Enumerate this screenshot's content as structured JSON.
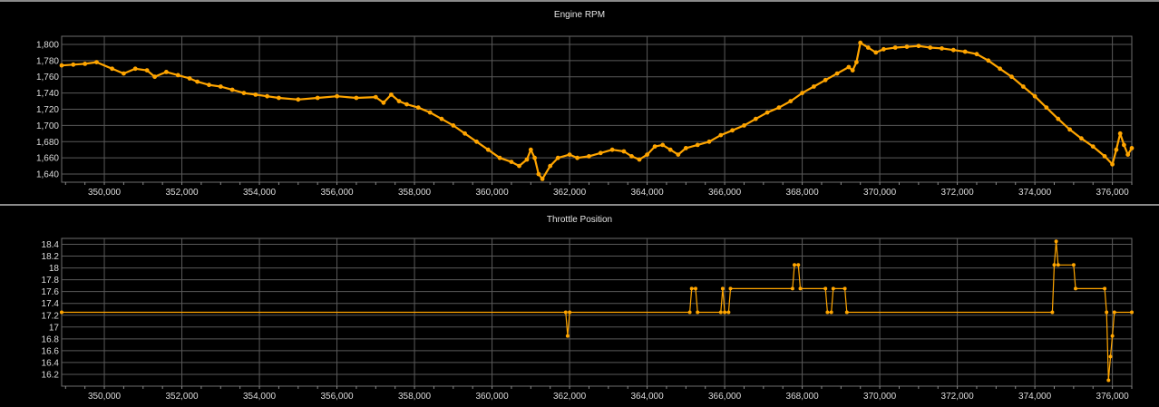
{
  "chart_data": [
    {
      "type": "line",
      "title": "Engine RPM",
      "xlabel": "",
      "ylabel": "",
      "xlim": [
        348900,
        376500
      ],
      "ylim": [
        1630,
        1810
      ],
      "x_ticks": [
        350000,
        352000,
        354000,
        356000,
        358000,
        360000,
        362000,
        364000,
        366000,
        368000,
        370000,
        372000,
        374000,
        376000
      ],
      "x_tick_labels": [
        "350,000",
        "352,000",
        "354,000",
        "356,000",
        "358,000",
        "360,000",
        "362,000",
        "364,000",
        "366,000",
        "368,000",
        "370,000",
        "372,000",
        "374,000",
        "376,000"
      ],
      "y_ticks": [
        1640,
        1660,
        1680,
        1700,
        1720,
        1740,
        1760,
        1780,
        1800
      ],
      "y_tick_labels": [
        "1,640",
        "1,660",
        "1,680",
        "1,700",
        "1,720",
        "1,740",
        "1,760",
        "1,780",
        "1,800"
      ],
      "grid": true,
      "color": "#FFA500",
      "series": [
        {
          "points": [
            [
              348900,
              1774
            ],
            [
              349200,
              1775
            ],
            [
              349500,
              1776
            ],
            [
              349800,
              1778
            ],
            [
              350200,
              1770
            ],
            [
              350500,
              1764
            ],
            [
              350800,
              1770
            ],
            [
              351100,
              1768
            ],
            [
              351300,
              1760
            ],
            [
              351600,
              1766
            ],
            [
              351900,
              1762
            ],
            [
              352200,
              1758
            ],
            [
              352400,
              1754
            ],
            [
              352700,
              1750
            ],
            [
              353000,
              1748
            ],
            [
              353300,
              1744
            ],
            [
              353600,
              1740
            ],
            [
              353900,
              1738
            ],
            [
              354200,
              1736
            ],
            [
              354500,
              1734
            ],
            [
              355000,
              1732
            ],
            [
              355500,
              1734
            ],
            [
              356000,
              1736
            ],
            [
              356500,
              1734
            ],
            [
              357000,
              1735
            ],
            [
              357200,
              1728
            ],
            [
              357400,
              1738
            ],
            [
              357600,
              1730
            ],
            [
              357800,
              1726
            ],
            [
              358100,
              1722
            ],
            [
              358400,
              1716
            ],
            [
              358700,
              1708
            ],
            [
              359000,
              1700
            ],
            [
              359300,
              1690
            ],
            [
              359600,
              1680
            ],
            [
              359900,
              1670
            ],
            [
              360200,
              1660
            ],
            [
              360500,
              1655
            ],
            [
              360700,
              1650
            ],
            [
              360900,
              1658
            ],
            [
              361000,
              1670
            ],
            [
              361100,
              1660
            ],
            [
              361200,
              1640
            ],
            [
              361300,
              1634
            ],
            [
              361500,
              1650
            ],
            [
              361700,
              1660
            ],
            [
              362000,
              1664
            ],
            [
              362200,
              1660
            ],
            [
              362500,
              1662
            ],
            [
              362800,
              1666
            ],
            [
              363100,
              1670
            ],
            [
              363400,
              1668
            ],
            [
              363600,
              1662
            ],
            [
              363800,
              1658
            ],
            [
              364000,
              1664
            ],
            [
              364200,
              1674
            ],
            [
              364400,
              1676
            ],
            [
              364600,
              1670
            ],
            [
              364800,
              1664
            ],
            [
              365000,
              1672
            ],
            [
              365300,
              1676
            ],
            [
              365600,
              1680
            ],
            [
              365900,
              1688
            ],
            [
              366200,
              1694
            ],
            [
              366500,
              1700
            ],
            [
              366800,
              1708
            ],
            [
              367100,
              1716
            ],
            [
              367400,
              1722
            ],
            [
              367700,
              1730
            ],
            [
              368000,
              1740
            ],
            [
              368300,
              1748
            ],
            [
              368600,
              1756
            ],
            [
              368900,
              1764
            ],
            [
              369200,
              1772
            ],
            [
              369300,
              1768
            ],
            [
              369400,
              1778
            ],
            [
              369500,
              1802
            ],
            [
              369700,
              1796
            ],
            [
              369900,
              1790
            ],
            [
              370100,
              1794
            ],
            [
              370400,
              1796
            ],
            [
              370700,
              1797
            ],
            [
              371000,
              1798
            ],
            [
              371300,
              1796
            ],
            [
              371600,
              1795
            ],
            [
              371900,
              1793
            ],
            [
              372200,
              1791
            ],
            [
              372500,
              1788
            ],
            [
              372800,
              1780
            ],
            [
              373100,
              1770
            ],
            [
              373400,
              1760
            ],
            [
              373700,
              1748
            ],
            [
              374000,
              1736
            ],
            [
              374300,
              1722
            ],
            [
              374600,
              1708
            ],
            [
              374900,
              1695
            ],
            [
              375200,
              1684
            ],
            [
              375500,
              1674
            ],
            [
              375800,
              1662
            ],
            [
              376000,
              1652
            ],
            [
              376100,
              1670
            ],
            [
              376200,
              1690
            ],
            [
              376300,
              1676
            ],
            [
              376400,
              1664
            ],
            [
              376500,
              1672
            ]
          ]
        }
      ]
    },
    {
      "type": "line",
      "title": "Throttle Position",
      "xlabel": "",
      "ylabel": "",
      "xlim": [
        348900,
        376500
      ],
      "ylim": [
        16.0,
        18.5
      ],
      "x_ticks": [
        350000,
        352000,
        354000,
        356000,
        358000,
        360000,
        362000,
        364000,
        366000,
        368000,
        370000,
        372000,
        374000,
        376000
      ],
      "x_tick_labels": [
        "350,000",
        "352,000",
        "354,000",
        "356,000",
        "358,000",
        "360,000",
        "362,000",
        "364,000",
        "366,000",
        "368,000",
        "370,000",
        "372,000",
        "374,000",
        "376,000"
      ],
      "y_ticks": [
        16.2,
        16.4,
        16.6,
        16.8,
        17,
        17.2,
        17.4,
        17.6,
        17.8,
        18,
        18.2,
        18.4
      ],
      "y_tick_labels": [
        "16.2",
        "16.4",
        "16.6",
        "16.8",
        "17",
        "17.2",
        "17.4",
        "17.6",
        "17.8",
        "18",
        "18.2",
        "18.4"
      ],
      "grid": true,
      "color": "#FFA500",
      "series": [
        {
          "points": [
            [
              348900,
              17.25
            ],
            [
              361900,
              17.25
            ],
            [
              361950,
              16.85
            ],
            [
              362000,
              17.25
            ],
            [
              365100,
              17.25
            ],
            [
              365150,
              17.65
            ],
            [
              365250,
              17.65
            ],
            [
              365300,
              17.25
            ],
            [
              365900,
              17.25
            ],
            [
              365950,
              17.65
            ],
            [
              366000,
              17.25
            ],
            [
              366100,
              17.25
            ],
            [
              366150,
              17.65
            ],
            [
              367750,
              17.65
            ],
            [
              367800,
              18.05
            ],
            [
              367900,
              18.05
            ],
            [
              367950,
              17.65
            ],
            [
              368600,
              17.65
            ],
            [
              368650,
              17.25
            ],
            [
              368750,
              17.25
            ],
            [
              368800,
              17.65
            ],
            [
              369100,
              17.65
            ],
            [
              369150,
              17.25
            ],
            [
              374450,
              17.25
            ],
            [
              374500,
              18.05
            ],
            [
              374550,
              18.45
            ],
            [
              374600,
              18.05
            ],
            [
              375000,
              18.05
            ],
            [
              375050,
              17.65
            ],
            [
              375800,
              17.65
            ],
            [
              375850,
              17.25
            ],
            [
              375900,
              16.1
            ],
            [
              375950,
              16.5
            ],
            [
              376000,
              16.85
            ],
            [
              376050,
              17.25
            ],
            [
              376500,
              17.25
            ]
          ]
        }
      ]
    }
  ]
}
